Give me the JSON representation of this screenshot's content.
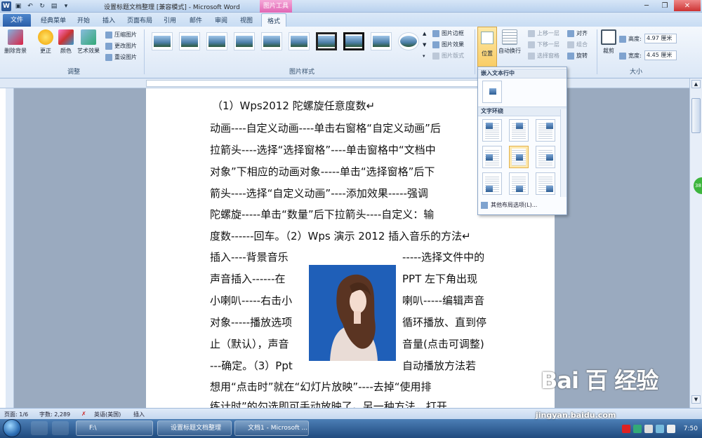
{
  "titlebar": {
    "title": "设置标题文档整理 [兼容模式] - Microsoft Word",
    "context_tab": "图片工具"
  },
  "tabs": {
    "file": "文件",
    "items": [
      "经典菜单",
      "开始",
      "插入",
      "页面布局",
      "引用",
      "邮件",
      "审阅",
      "视图",
      "格式"
    ]
  },
  "ribbon": {
    "adjust": {
      "remove_bg": "删除背景",
      "correct": "更正",
      "color": "颜色",
      "art": "艺术效果",
      "compress": "压缩图片",
      "change": "更改图片",
      "reset": "重设图片",
      "label": "调整"
    },
    "styles": {
      "label": "图片样式",
      "border": "图片边框",
      "effect": "图片效果",
      "layout": "图片版式"
    },
    "arrange": {
      "position": "位置",
      "wrap": "自动换行",
      "forward": "上移一层",
      "backward": "下移一层",
      "selection": "选择窗格",
      "align": "对齐",
      "group": "组合",
      "rotate": "旋转"
    },
    "size": {
      "crop": "裁剪",
      "height_label": "高度:",
      "height": "4.97 厘米",
      "width_label": "宽度:",
      "width": "4.45 厘米",
      "label": "大小"
    }
  },
  "dropdown": {
    "inline_header": "嵌入文本行中",
    "wrap_header": "文字环绕",
    "more": "其他布局选项(L)..."
  },
  "document": {
    "lines": [
      "（1）Wps2012 陀螺旋任意度数↵",
      "动画----自定义动画----单击右窗格“自定义动画”后",
      "拉箭头----选择“选择窗格”----单击窗格中“文档中",
      "对象”下相应的动画对象-----单击“选择窗格”后下",
      "箭头----选择“自定义动画”----添加效果-----强调",
      "陀螺旋-----单击“数量”后下拉箭头----自定义：输",
      "度数------回车。（2）Wps 演示 2012 插入音乐的方法↵"
    ],
    "left_lines": [
      "插入----背景音乐",
      "声音插入------在",
      "小喇叭-----右击小",
      "对象-----播放选项",
      "止（默认），声音",
      "---确定。（3）Ppt"
    ],
    "right_lines": [
      "-----选择文件中的",
      "PPT  左下角出现",
      "喇叭-----编辑声音",
      "循环播放、直到停",
      "音量(点击可调整)",
      "自动播放方法若"
    ],
    "tail_lines": [
      "想用“点击时”就在“幻灯片放映”----去掉“使用排",
      "练计时”的勾选即可手动放映了。另一种方法，打开"
    ]
  },
  "statusbar": {
    "page": "页面: 1/6",
    "words": "字数: 2,289",
    "lang": "英语(美国)",
    "mode": "插入"
  },
  "taskbar": {
    "folder": "F:\\",
    "task1": "设置标题文档整理",
    "task2": "文档1 - Microsoft ...",
    "time": "7:50"
  },
  "side_badge": "38",
  "watermark": {
    "logo": "Bai 百 经验",
    "url": "jingyan.baidu.com"
  }
}
